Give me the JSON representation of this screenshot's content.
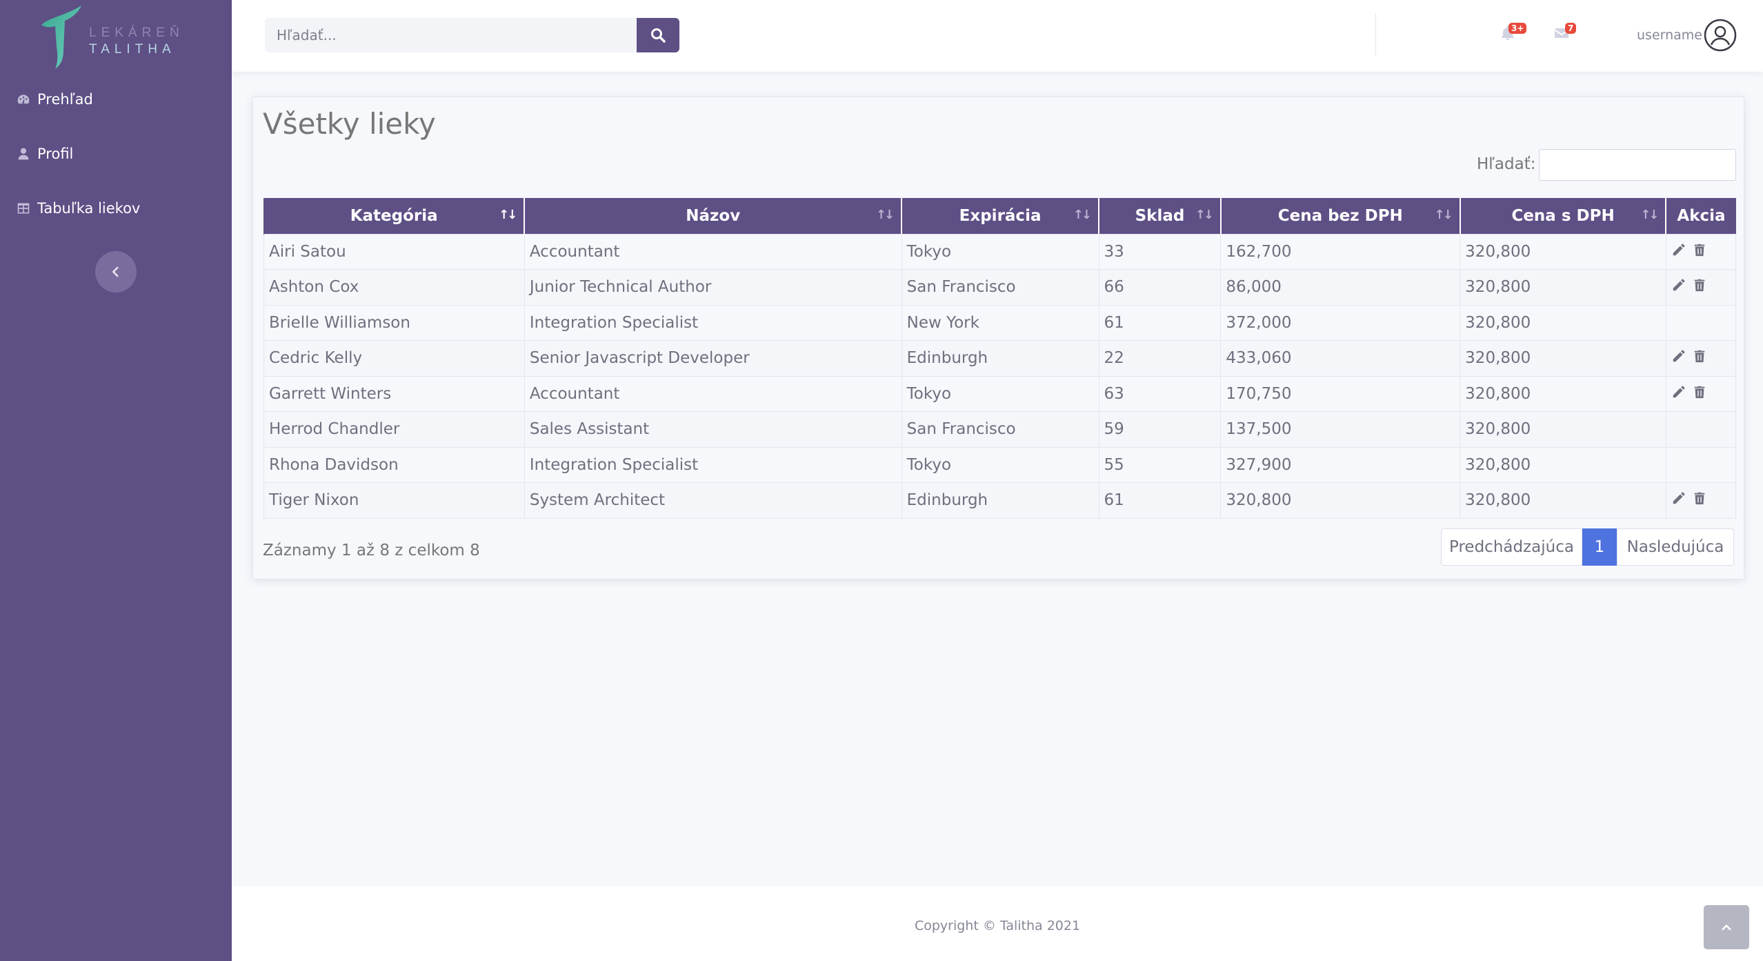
{
  "brand": {
    "line1": "LEKÁREŇ",
    "line2": "TALITHA"
  },
  "sidebar": {
    "items": [
      {
        "label": "Prehľad",
        "icon": "tachometer-icon"
      },
      {
        "label": "Profil",
        "icon": "user-icon"
      },
      {
        "label": "Tabuľka liekov",
        "icon": "table-icon"
      }
    ]
  },
  "topbar": {
    "search_placeholder": "Hľadať...",
    "alerts_badge": "3+",
    "messages_badge": "7",
    "username": "username"
  },
  "card": {
    "title": "Všetky lieky",
    "filter_label": "Hľadať:",
    "columns": [
      "Kategória",
      "Názov",
      "Expirácia",
      "Sklad",
      "Cena bez DPH",
      "Cena s DPH",
      "Akcia"
    ],
    "rows": [
      {
        "kategoria": "Airi Satou",
        "nazov": "Accountant",
        "expiracia": "Tokyo",
        "sklad": "33",
        "cena_bez": "162,700",
        "cena_s": "320,800",
        "actions": true
      },
      {
        "kategoria": "Ashton Cox",
        "nazov": "Junior Technical Author",
        "expiracia": "San Francisco",
        "sklad": "66",
        "cena_bez": "86,000",
        "cena_s": "320,800",
        "actions": true
      },
      {
        "kategoria": "Brielle Williamson",
        "nazov": "Integration Specialist",
        "expiracia": "New York",
        "sklad": "61",
        "cena_bez": "372,000",
        "cena_s": "320,800",
        "actions": false
      },
      {
        "kategoria": "Cedric Kelly",
        "nazov": "Senior Javascript Developer",
        "expiracia": "Edinburgh",
        "sklad": "22",
        "cena_bez": "433,060",
        "cena_s": "320,800",
        "actions": true
      },
      {
        "kategoria": "Garrett Winters",
        "nazov": "Accountant",
        "expiracia": "Tokyo",
        "sklad": "63",
        "cena_bez": "170,750",
        "cena_s": "320,800",
        "actions": true
      },
      {
        "kategoria": "Herrod Chandler",
        "nazov": "Sales Assistant",
        "expiracia": "San Francisco",
        "sklad": "59",
        "cena_bez": "137,500",
        "cena_s": "320,800",
        "actions": false
      },
      {
        "kategoria": "Rhona Davidson",
        "nazov": "Integration Specialist",
        "expiracia": "Tokyo",
        "sklad": "55",
        "cena_bez": "327,900",
        "cena_s": "320,800",
        "actions": false
      },
      {
        "kategoria": "Tiger Nixon",
        "nazov": "System Architect",
        "expiracia": "Edinburgh",
        "sklad": "61",
        "cena_bez": "320,800",
        "cena_s": "320,800",
        "actions": true
      }
    ],
    "info": "Záznamy 1 až 8 z celkom 8",
    "pager": {
      "prev": "Predchádzajúca",
      "current": "1",
      "next": "Nasledujúca"
    }
  },
  "footer": {
    "copyright": "Copyright © Talitha 2021"
  },
  "colors": {
    "primary": "#5e4f85",
    "accent": "#4e73df",
    "badge": "#e74a3b"
  }
}
